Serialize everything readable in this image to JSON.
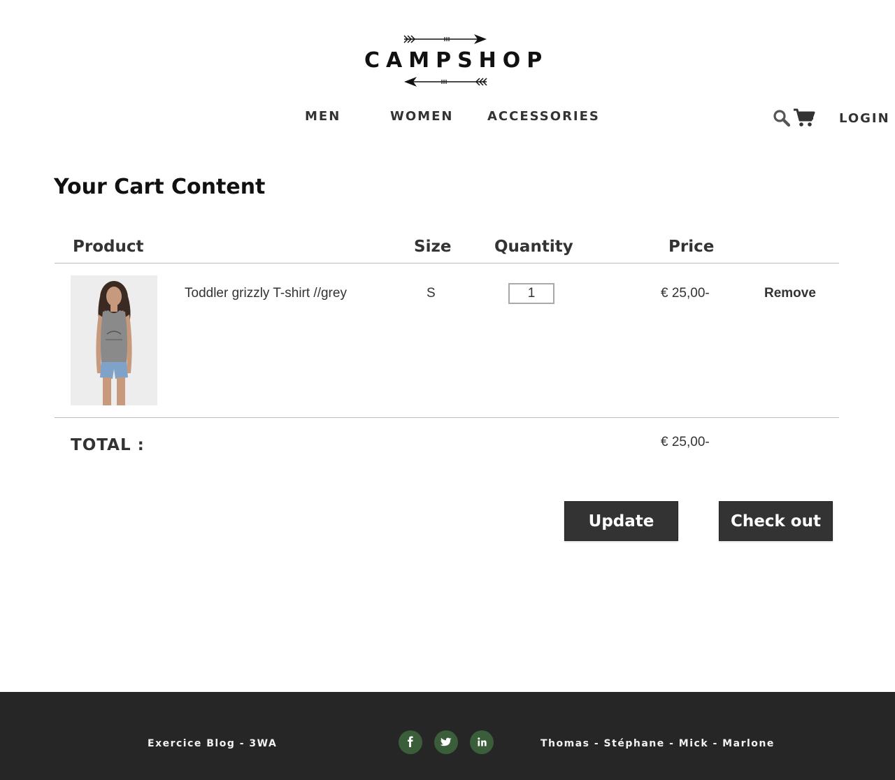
{
  "header": {
    "logo_text": "CAMPSHOP",
    "nav": [
      "MEN",
      "WOMEN",
      "ACCESSORIES"
    ],
    "login_label": "LOGIN",
    "icons": [
      "search-icon",
      "cart-icon"
    ]
  },
  "page_title": "Your Cart Content",
  "cart": {
    "columns": [
      "Product",
      "Size",
      "Quantity",
      "Price"
    ],
    "items": [
      {
        "name": "Toddler grizzly T-shirt //grey",
        "size": "S",
        "quantity": "1",
        "price": "€ 25,00-",
        "remove_label": "Remove"
      }
    ],
    "total_label": "TOTAL :",
    "total_value": "€ 25,00-"
  },
  "actions": {
    "update_label": "Update",
    "checkout_label": "Check out"
  },
  "footer": {
    "left_text": "Exercice Blog - 3WA",
    "right_text": "Thomas - Stéphane - Mick - Marlone",
    "social_icons": [
      "facebook-icon",
      "twitter-icon",
      "linkedin-icon"
    ],
    "social_color": "#3a5e3a",
    "background": "#262626"
  }
}
